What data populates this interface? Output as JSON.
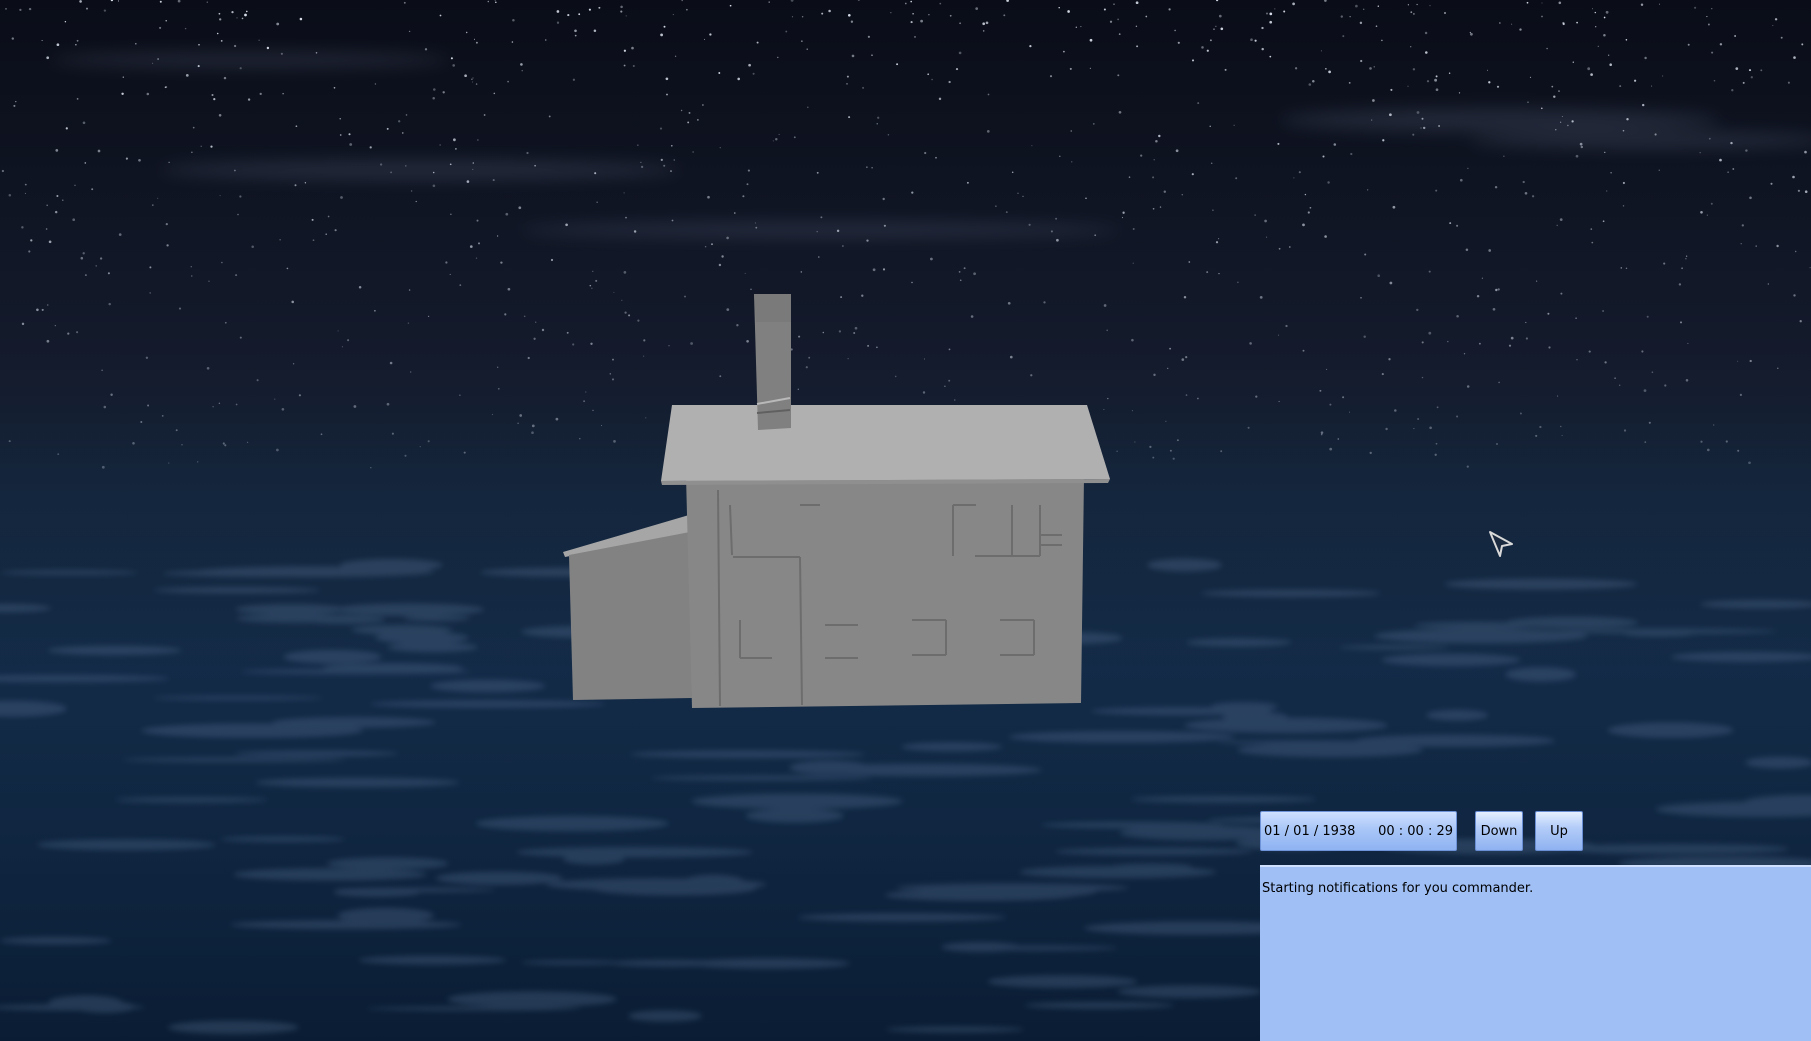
{
  "hud": {
    "date": "01 / 01 / 1938",
    "time": "00 : 00 : 29",
    "down_label": "Down",
    "up_label": "Up"
  },
  "notifications": {
    "message": "Starting notifications for you commander."
  },
  "colors": {
    "sky_top": "#0d1220",
    "sea": "#0e2640",
    "house": "#8a8a8a",
    "roof": "#b5b5b5",
    "panel": "#9fbff5"
  },
  "icons": {
    "cursor": "mouse-pointer-icon"
  }
}
